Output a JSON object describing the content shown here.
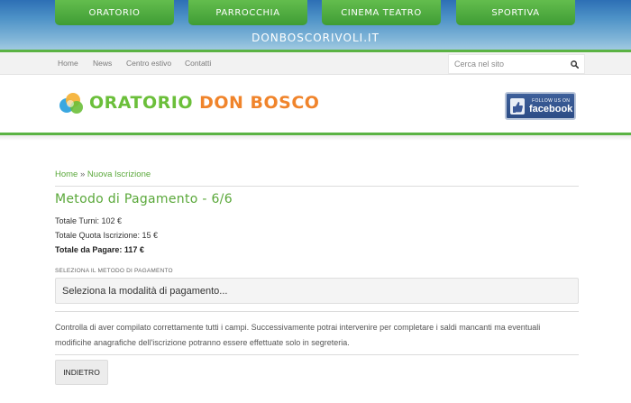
{
  "top_tabs": [
    {
      "label": "ORATORIO"
    },
    {
      "label": "PARROCCHIA"
    },
    {
      "label": "CINEMA TEATRO"
    },
    {
      "label": "SPORTIVA"
    }
  ],
  "site_url": "DONBOSCORIVOLI.IT",
  "nav": {
    "items": [
      {
        "label": "Home"
      },
      {
        "label": "News"
      },
      {
        "label": "Centro estivo"
      },
      {
        "label": "Contatti"
      }
    ],
    "search_placeholder": "Cerca nel sito"
  },
  "logo": {
    "word1": "ORATORIO",
    "word2": "DON BOSCO"
  },
  "facebook_badge": {
    "follow": "FOLLOW US ON",
    "brand": "facebook"
  },
  "breadcrumb": {
    "home": "Home",
    "separator": "»",
    "current": "Nuova Iscrizione"
  },
  "page_title": "Metodo di Pagamento - 6/6",
  "summary": {
    "turni": "Totale Turni: 102 €",
    "quota": "Totale Quota Iscrizione: 15 €",
    "totale": "Totale da Pagare: 117 €"
  },
  "payment": {
    "section_label": "SELEZIONA IL METODO DI PAGAMENTO",
    "select_value": "Seleziona la modalità di pagamento..."
  },
  "notice_line1": "Controlla di aver compilato correttamente tutti i campi. Successivamente potrai intervenire per completare i saldi mancanti ma eventuali",
  "notice_line2": "modificihe anagrafiche dell'iscrizione potranno essere effettuate solo in segreteria.",
  "back_button": "INDIETRO",
  "colors": {
    "green": "#5bb344",
    "orange": "#f0842b",
    "banner_blue": "#2d6fb5",
    "facebook_blue": "#3b5998"
  }
}
